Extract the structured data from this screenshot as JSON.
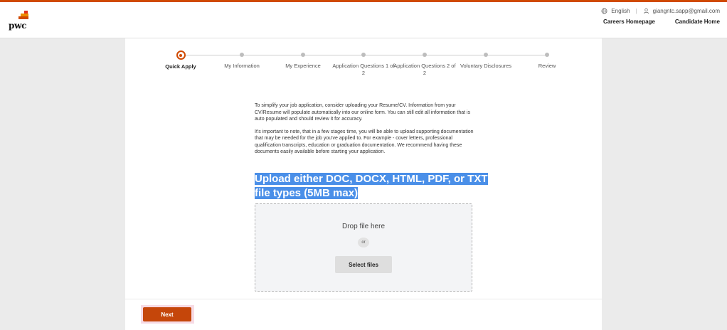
{
  "brand": {
    "logo_text": "pwc",
    "accent_color": "#d04a02"
  },
  "header": {
    "language": "English",
    "language_icon": "globe-icon",
    "user_email": "giangntc.sapp@gmail.com",
    "user_icon": "user-icon",
    "nav": {
      "careers_homepage": "Careers Homepage",
      "candidate_home": "Candidate Home"
    }
  },
  "stepper": {
    "steps": [
      {
        "label": "Quick Apply",
        "active": true
      },
      {
        "label": "My Information",
        "active": false
      },
      {
        "label": "My Experience",
        "active": false
      },
      {
        "label": "Application Questions 1 of 2",
        "active": false
      },
      {
        "label": "Application Questions 2 of 2",
        "active": false
      },
      {
        "label": "Voluntary Disclosures",
        "active": false
      },
      {
        "label": "Review",
        "active": false
      }
    ]
  },
  "main": {
    "intro_paragraph_1": "To simplify your job application, consider uploading your Resume/CV. Information from your CV/Resume will populate automatically into our online form.  You can still edit all information that is auto populated and should review it for accuracy.",
    "intro_paragraph_2": "It's important to note, that in a few stages time, you will be able to upload supporting documentation that may be needed for the job you've applied to. For example - cover letters, professional qualification transcripts, education or graduation documentation. We recommend having these documents easily available before starting your application.",
    "upload_title_line_1": "Upload either DOC, DOCX, HTML, PDF, or TXT",
    "upload_title_line_2": "file types (5MB max)",
    "dropzone": {
      "drop_text": "Drop file here",
      "or_text": "or",
      "select_button": "Select files"
    }
  },
  "footer": {
    "next_button": "Next"
  }
}
